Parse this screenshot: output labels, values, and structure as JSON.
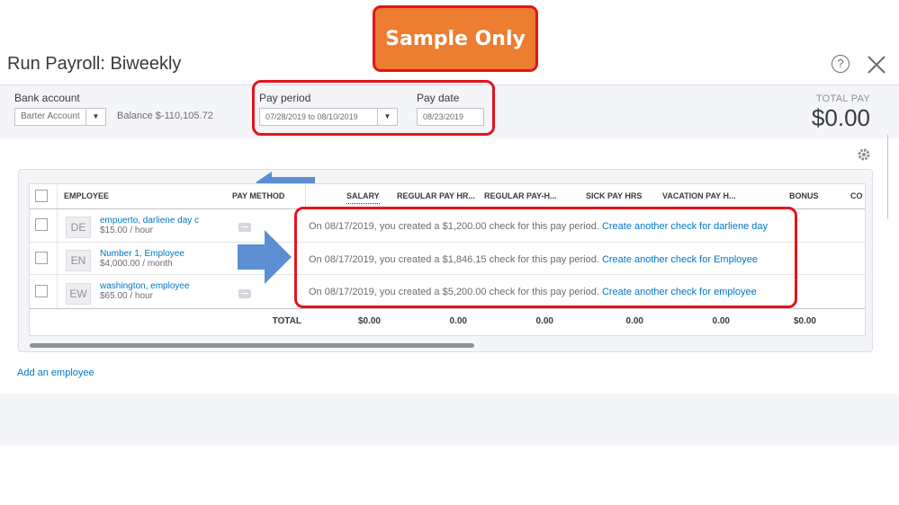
{
  "badge": {
    "label": "Sample Only"
  },
  "header": {
    "title": "Run Payroll: Biweekly"
  },
  "bank": {
    "label": "Bank account",
    "account": "Barter Account",
    "balance": "Balance $-110,105.72"
  },
  "pay_period": {
    "label": "Pay period",
    "value": "07/28/2019 to 08/10/2019"
  },
  "pay_date": {
    "label": "Pay date",
    "value": "08/23/2019"
  },
  "total_pay": {
    "label": "TOTAL PAY",
    "value": "$0.00"
  },
  "table": {
    "columns": {
      "employee": "EMPLOYEE",
      "pay_method": "PAY METHOD",
      "salary": "SALARY",
      "regular_pay_hrs": "REGULAR PAY HR...",
      "regular_pay_h": "REGULAR PAY-H...",
      "sick_pay_hrs": "SICK PAY HRS",
      "vacation_pay_h": "VACATION PAY H...",
      "bonus": "BONUS",
      "co": "CO"
    },
    "rows": [
      {
        "initials": "DE",
        "name": "empuerto, darliene day c",
        "rate": "$15.00 / hour",
        "message": "On 08/17/2019, you created a $1,200.00 check for this pay period.",
        "link": "Create another check for darliene day"
      },
      {
        "initials": "EN",
        "name": "Number 1, Employee",
        "rate": "$4,000.00 / month",
        "message": "On 08/17/2019, you created a $1,846.15 check for this pay period.",
        "link": "Create another check for Employee"
      },
      {
        "initials": "EW",
        "name": "washington, employee",
        "rate": "$65.00 / hour",
        "message": "On 08/17/2019, you created a $5,200.00 check for this pay period.",
        "link": "Create another check for employee"
      }
    ],
    "totals": {
      "label": "TOTAL",
      "salary": "$0.00",
      "regular_pay_hrs": "0.00",
      "regular_pay_h": "0.00",
      "sick_pay_hrs": "0.00",
      "vacation_pay_h": "0.00",
      "bonus": "$0.00"
    }
  },
  "add_employee": "Add an employee",
  "colors": {
    "badge_fill": "#ed7d31",
    "highlight_red": "#e3141b",
    "annotation_arrow": "#5b8fd1",
    "link_blue": "#0077c5"
  }
}
